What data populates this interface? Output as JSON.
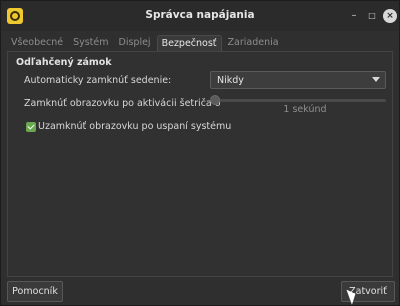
{
  "window": {
    "title": "Správca napájania"
  },
  "tabs": [
    {
      "label": "Všeobecné",
      "active": false
    },
    {
      "label": "Systém",
      "active": false
    },
    {
      "label": "Displej",
      "active": false
    },
    {
      "label": "Bezpečnosť",
      "active": true
    },
    {
      "label": "Zariadenia",
      "active": false
    }
  ],
  "security": {
    "section_title": "Odľahčený zámok",
    "auto_lock_label": "Automaticky zamknúť sedenie:",
    "auto_lock_value": "Nikdy",
    "lock_after_saver_label": "Zamknúť obrazovku po aktivácii šetriča o",
    "lock_after_saver_value_text": "1 sekúnd",
    "lock_after_saver_level": 0,
    "lock_on_sleep_label": "Uzamknúť obrazovku po uspaní systému",
    "lock_on_sleep_checked": true
  },
  "buttons": {
    "help": "Pomocník",
    "close": "Zatvoriť"
  },
  "colors": {
    "accent": "#6aa84f",
    "app_icon": "#f0c830"
  }
}
